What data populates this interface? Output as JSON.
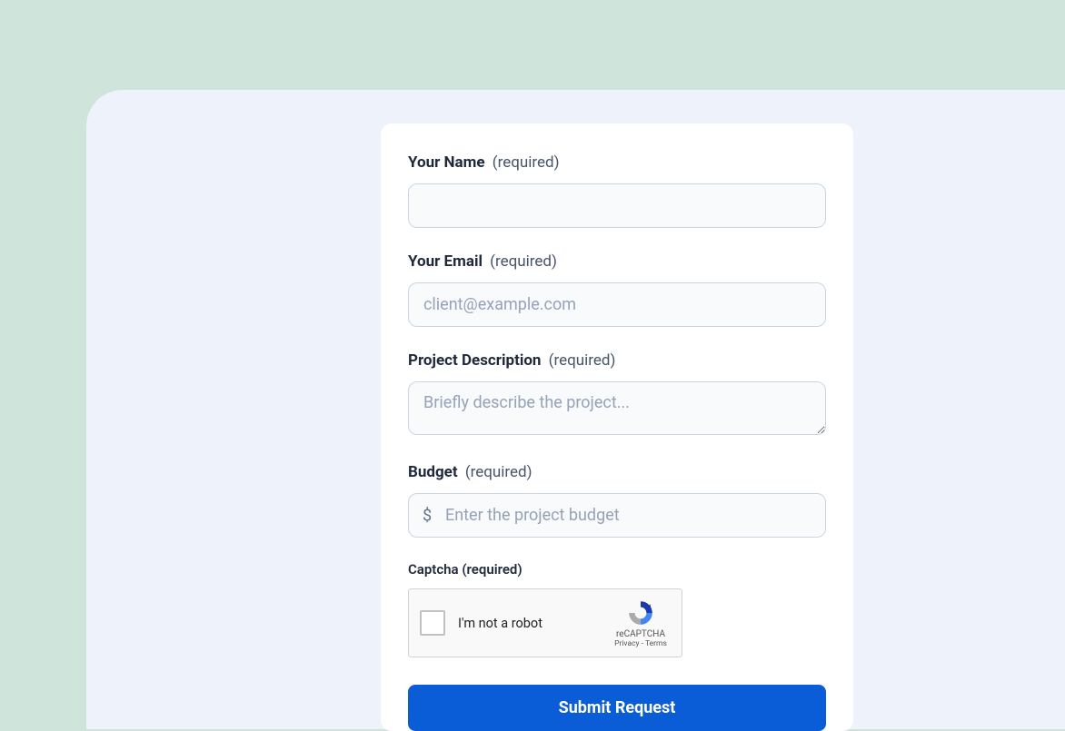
{
  "form": {
    "name": {
      "label": "Your Name",
      "required": "(required)",
      "value": "",
      "placeholder": ""
    },
    "email": {
      "label": "Your Email",
      "required": "(required)",
      "value": "",
      "placeholder": "client@example.com"
    },
    "description": {
      "label": "Project Description",
      "required": "(required)",
      "value": "",
      "placeholder": "Briefly describe the project..."
    },
    "budget": {
      "label": "Budget",
      "required": "(required)",
      "value": "",
      "placeholder": "Enter the project budget",
      "currency_symbol": "$"
    },
    "captcha": {
      "label": "Captcha (required)",
      "checkbox_text": "I'm not a robot",
      "brand": "reCAPTCHA",
      "links": "Privacy - Terms"
    },
    "submit_label": "Submit Request"
  }
}
